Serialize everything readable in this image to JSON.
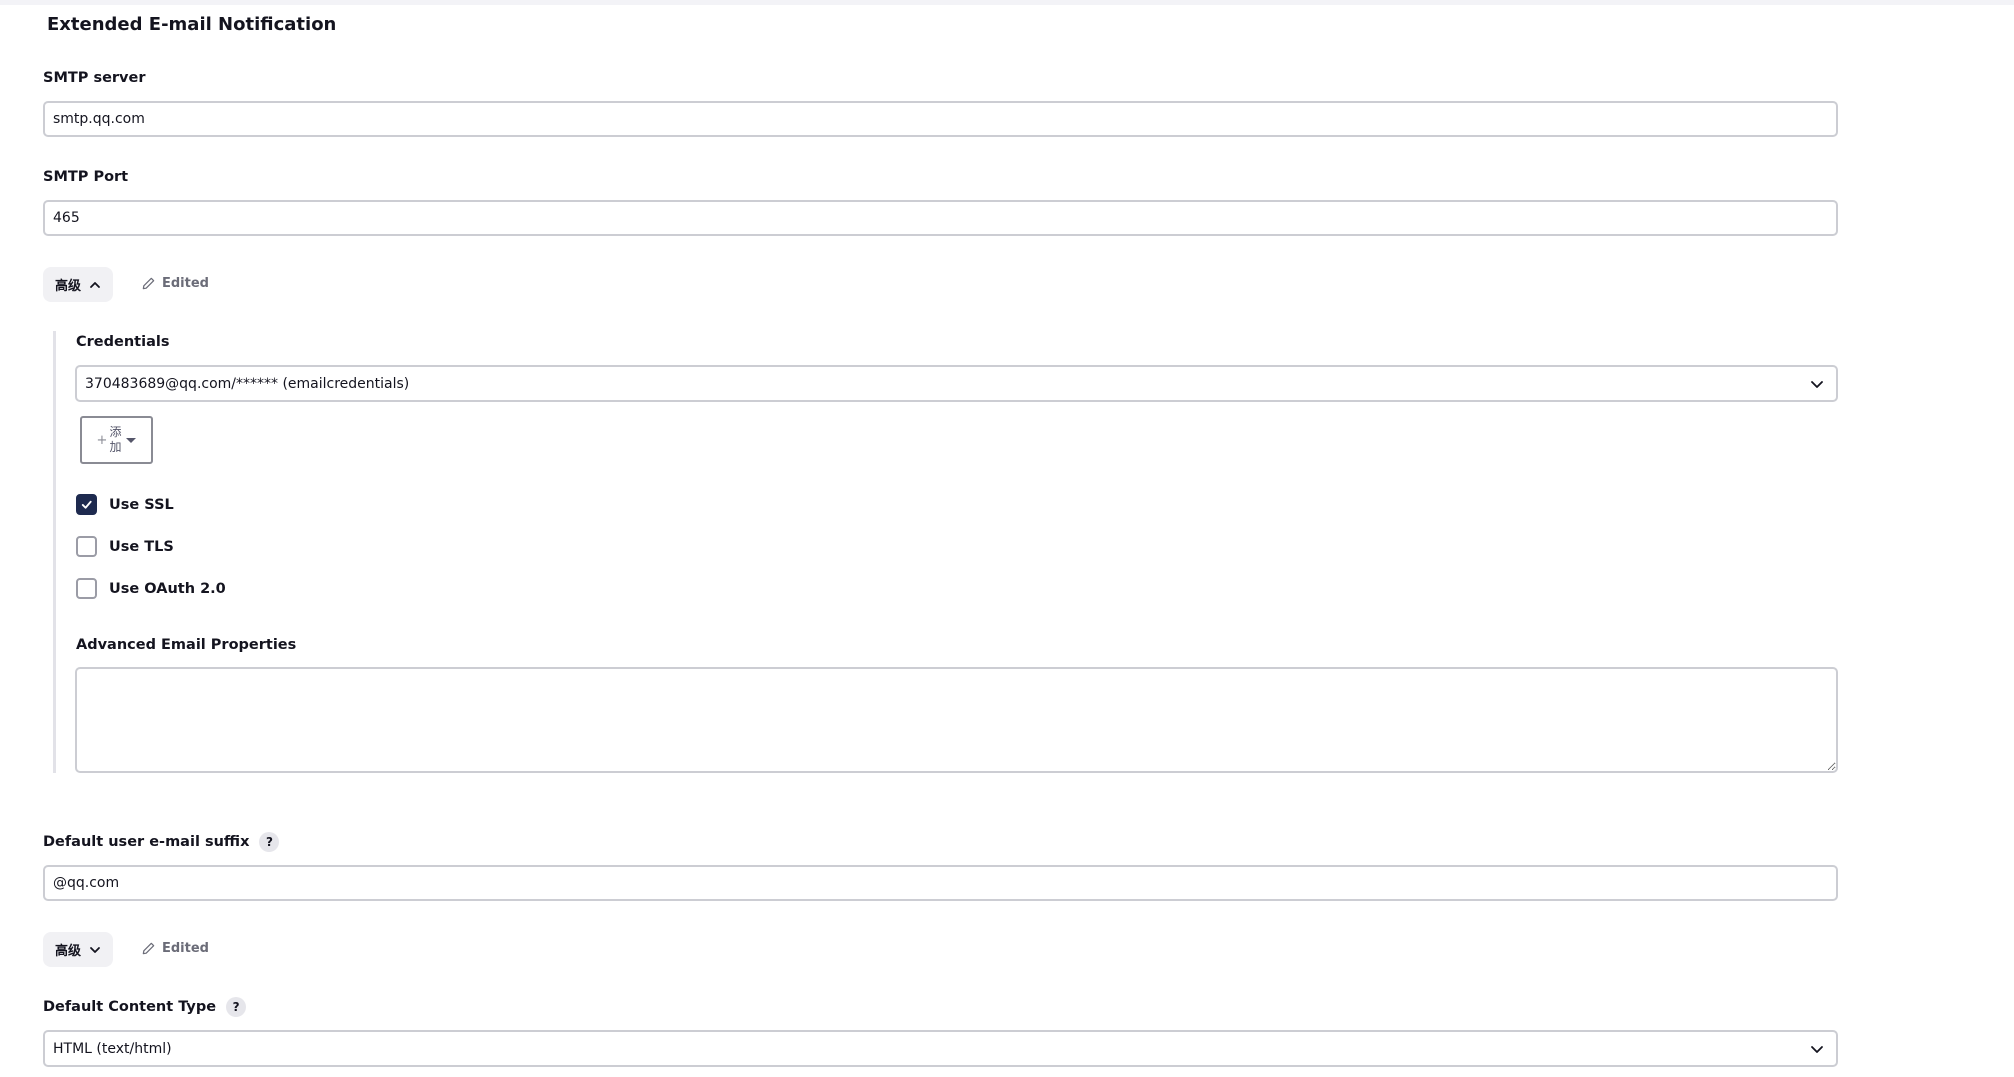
{
  "section": {
    "title": "Extended E-mail Notification"
  },
  "smtp_server": {
    "label": "SMTP server",
    "value": "smtp.qq.com"
  },
  "smtp_port": {
    "label": "SMTP Port",
    "value": "465"
  },
  "advanced_1": {
    "label": "高级",
    "expanded": true,
    "edited_label": "Edited"
  },
  "credentials": {
    "label": "Credentials",
    "selected": "370483689@qq.com/****** (emailcredentials)",
    "add_button_line1": "添",
    "add_button_line2": "加",
    "add_button_plus": "+"
  },
  "checkboxes": [
    {
      "label": "Use SSL",
      "checked": true
    },
    {
      "label": "Use TLS",
      "checked": false
    },
    {
      "label": "Use OAuth 2.0",
      "checked": false
    }
  ],
  "advanced_email_properties": {
    "label": "Advanced Email Properties",
    "value": ""
  },
  "default_suffix": {
    "label": "Default user e-mail suffix",
    "help": "?",
    "value": "@qq.com"
  },
  "advanced_2": {
    "label": "高级",
    "expanded": false,
    "edited_label": "Edited"
  },
  "default_content_type": {
    "label": "Default Content Type",
    "help": "?",
    "selected": "HTML (text/html)"
  },
  "colors": {
    "accent": "#1e2a4f",
    "border": "#cccdd3",
    "muted_text": "#6b6c78"
  }
}
